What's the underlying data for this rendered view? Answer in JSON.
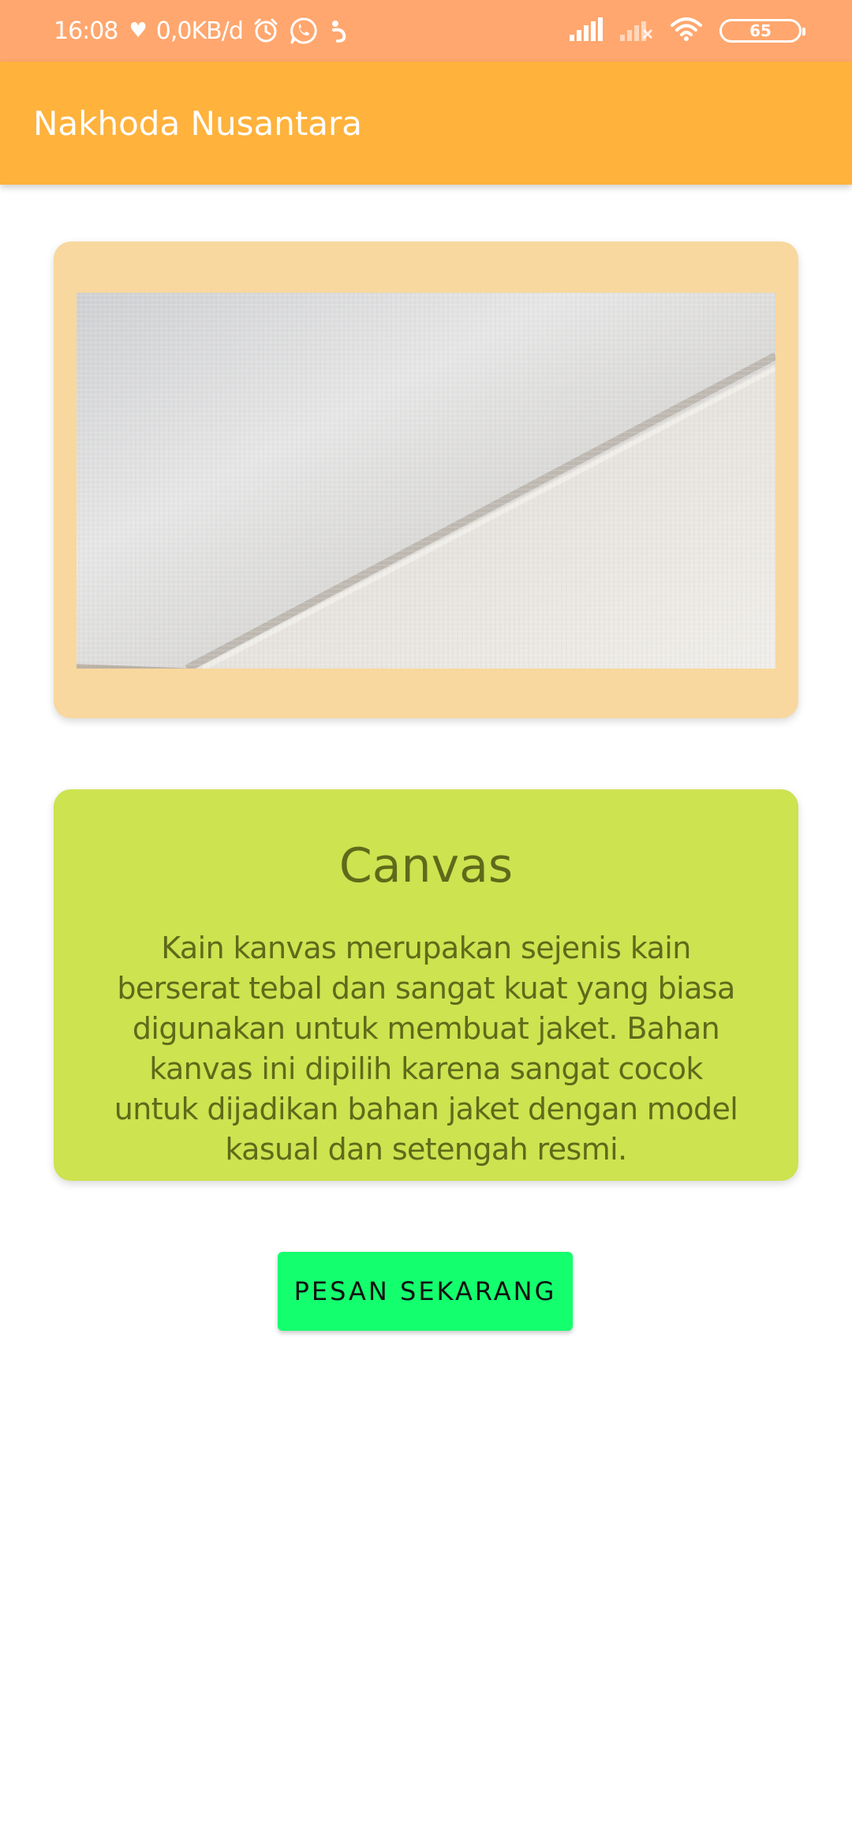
{
  "status_bar": {
    "time": "16:08",
    "network_speed": "0,0KB/d",
    "battery_level": "65",
    "icons": [
      "heart-icon",
      "alarm-icon",
      "whatsapp-icon",
      "notification-icon",
      "signal-icon",
      "signal-weak-icon",
      "wifi-icon",
      "battery-icon"
    ]
  },
  "app_bar": {
    "title": "Nakhoda Nusantara"
  },
  "product": {
    "name": "Canvas",
    "description": "Kain kanvas merupakan sejenis kain berserat tebal dan sangat kuat yang biasa digunakan untuk membuat jaket. Bahan kanvas ini dipilih karena sangat cocok untuk dijadikan bahan jaket dengan model kasual dan setengah resmi."
  },
  "actions": {
    "order_label": "PESAN SEKARANG"
  },
  "colors": {
    "status_bar": "#FFA76E",
    "app_bar": "#FFB23C",
    "image_card": "#F8D89E",
    "desc_card": "#CDE350",
    "desc_text": "#5F6A1A",
    "order_button": "#14FF6E"
  }
}
